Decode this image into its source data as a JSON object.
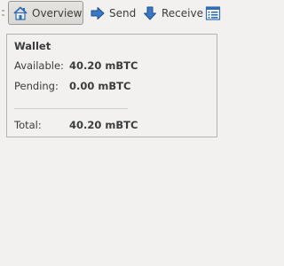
{
  "toolbar": {
    "overview_label": "Overview",
    "send_label": "Send",
    "receive_label": "Receive",
    "icons": {
      "overview": "home-icon",
      "send": "send-arrow-icon",
      "receive": "receive-arrow-icon",
      "more": "list-icon"
    },
    "active_tab": "Overview"
  },
  "wallet": {
    "title": "Wallet",
    "available_label": "Available:",
    "available_value": "40.20 mBTC",
    "pending_label": "Pending:",
    "pending_value": "0.00 mBTC",
    "total_label": "Total:",
    "total_value": "40.20 mBTC"
  },
  "colors": {
    "background": "#f2f1f0",
    "icon_blue": "#2f6db5",
    "text": "#3c3c3c"
  }
}
